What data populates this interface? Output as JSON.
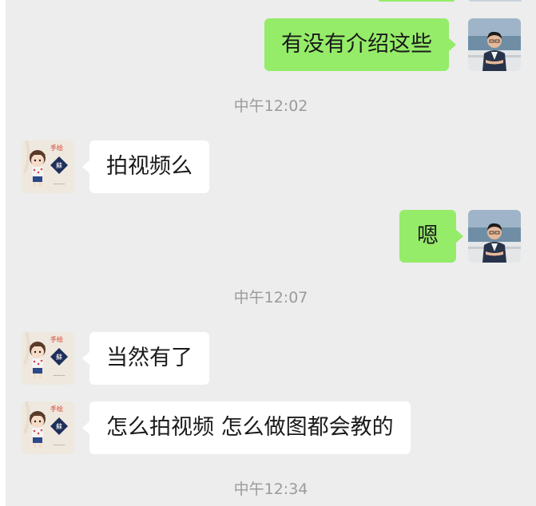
{
  "messages": [
    {
      "direction": "out",
      "text": "有没有介绍这些",
      "avatar": "man-avatar"
    },
    {
      "time": "中午12:02"
    },
    {
      "direction": "in",
      "text": "拍视频么",
      "avatar": "girl-avatar"
    },
    {
      "direction": "out",
      "text": "嗯",
      "avatar": "man-avatar"
    },
    {
      "time": "中午12:07"
    },
    {
      "direction": "in",
      "text": "当然有了",
      "avatar": "girl-avatar"
    },
    {
      "direction": "in",
      "text": "怎么拍视频 怎么做图都会教的",
      "avatar": "girl-avatar"
    },
    {
      "time": "中午12:34"
    }
  ],
  "colors": {
    "background": "#ededed",
    "outgoing_bubble": "#95ec69",
    "incoming_bubble": "#ffffff",
    "timestamp_text": "#9b9b9b"
  }
}
